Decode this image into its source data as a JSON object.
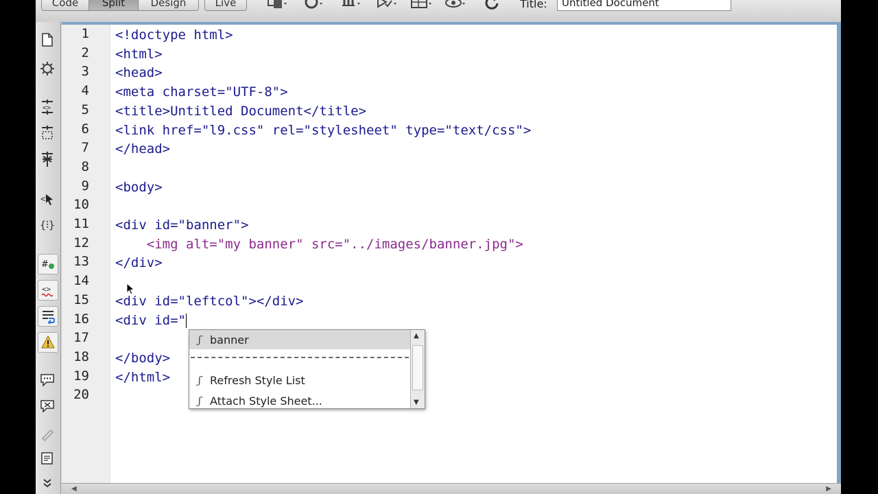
{
  "toolbar": {
    "views": [
      {
        "label": "Code",
        "active": false
      },
      {
        "label": "Split",
        "active": true
      },
      {
        "label": "Design",
        "active": false
      },
      {
        "label": "Live",
        "active": false
      }
    ],
    "title_label": "Title:",
    "title_value": "Untitled Document",
    "icons": [
      "multiscreen-icon",
      "preview-browser-icon",
      "file-management-icon",
      "validate-icon",
      "visual-aids-icon",
      "live-view-icon",
      "refresh-icon"
    ]
  },
  "left_toolbar": {
    "icons": [
      "open-documents-icon",
      "show-code-navigator-icon",
      "collapse-tag-icon",
      "collapse-selection-icon",
      "expand-all-icon",
      "select-parent-tag-icon",
      "balance-braces-icon",
      "line-numbers-icon",
      "highlight-invalid-code-icon",
      "word-wrap-icon",
      "syntax-error-alerts-icon",
      "apply-comment-icon",
      "remove-comment-icon",
      "wrap-tag-icon",
      "recent-snippets-icon",
      "more-icon"
    ]
  },
  "editor": {
    "lines": [
      {
        "n": "1",
        "code": "<!doctype html>"
      },
      {
        "n": "2",
        "code": "<html>"
      },
      {
        "n": "3",
        "code": "<head>"
      },
      {
        "n": "4",
        "code": "<meta charset=\"UTF-8\">"
      },
      {
        "n": "5",
        "code": "<title>Untitled Document</title>"
      },
      {
        "n": "6",
        "code": "<link href=\"l9.css\" rel=\"stylesheet\" type=\"text/css\">"
      },
      {
        "n": "7",
        "code": "</head>"
      },
      {
        "n": "8",
        "code": ""
      },
      {
        "n": "9",
        "code": "<body>"
      },
      {
        "n": "10",
        "code": ""
      },
      {
        "n": "11",
        "code": "<div id=\"banner\">"
      },
      {
        "n": "12",
        "code": "    <img alt=\"my banner\" src=\"../images/banner.jpg\">"
      },
      {
        "n": "13",
        "code": "</div>"
      },
      {
        "n": "14",
        "code": ""
      },
      {
        "n": "15",
        "code": "<div id=\"leftcol\"></div>"
      },
      {
        "n": "16",
        "code": "<div id=\""
      },
      {
        "n": "17",
        "code": ""
      },
      {
        "n": "18",
        "code": "</body>"
      },
      {
        "n": "19",
        "code": "</html>"
      },
      {
        "n": "20",
        "code": ""
      }
    ]
  },
  "code_hints": {
    "items": [
      {
        "label": "banner",
        "selected": true
      },
      {
        "label": "Refresh Style List",
        "selected": false
      },
      {
        "label": "Attach Style Sheet...",
        "selected": false
      }
    ],
    "icon": "css-style-icon"
  }
}
